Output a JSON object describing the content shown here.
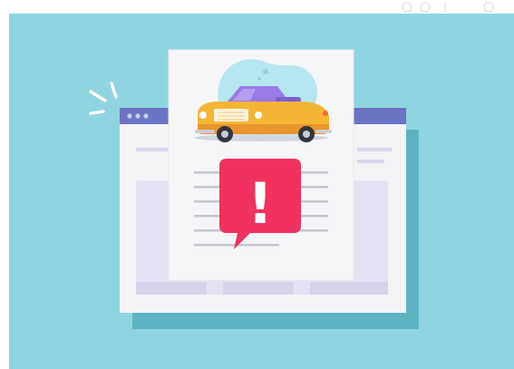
{
  "illustration": {
    "subject": "car-document-warning",
    "alert_symbol": "!",
    "colors": {
      "background": "#8fd5df",
      "window_bar": "#6a74c2",
      "page": "#f6f6f8",
      "alert": "#f1325e",
      "car_body": "#f5b534",
      "car_glass": "#9a7be6",
      "blob": "#b6e6ef"
    },
    "icons": [
      "window-dots-icon",
      "sparkle-lines-icon",
      "car-icon",
      "warning-speech-bubble-icon"
    ]
  }
}
